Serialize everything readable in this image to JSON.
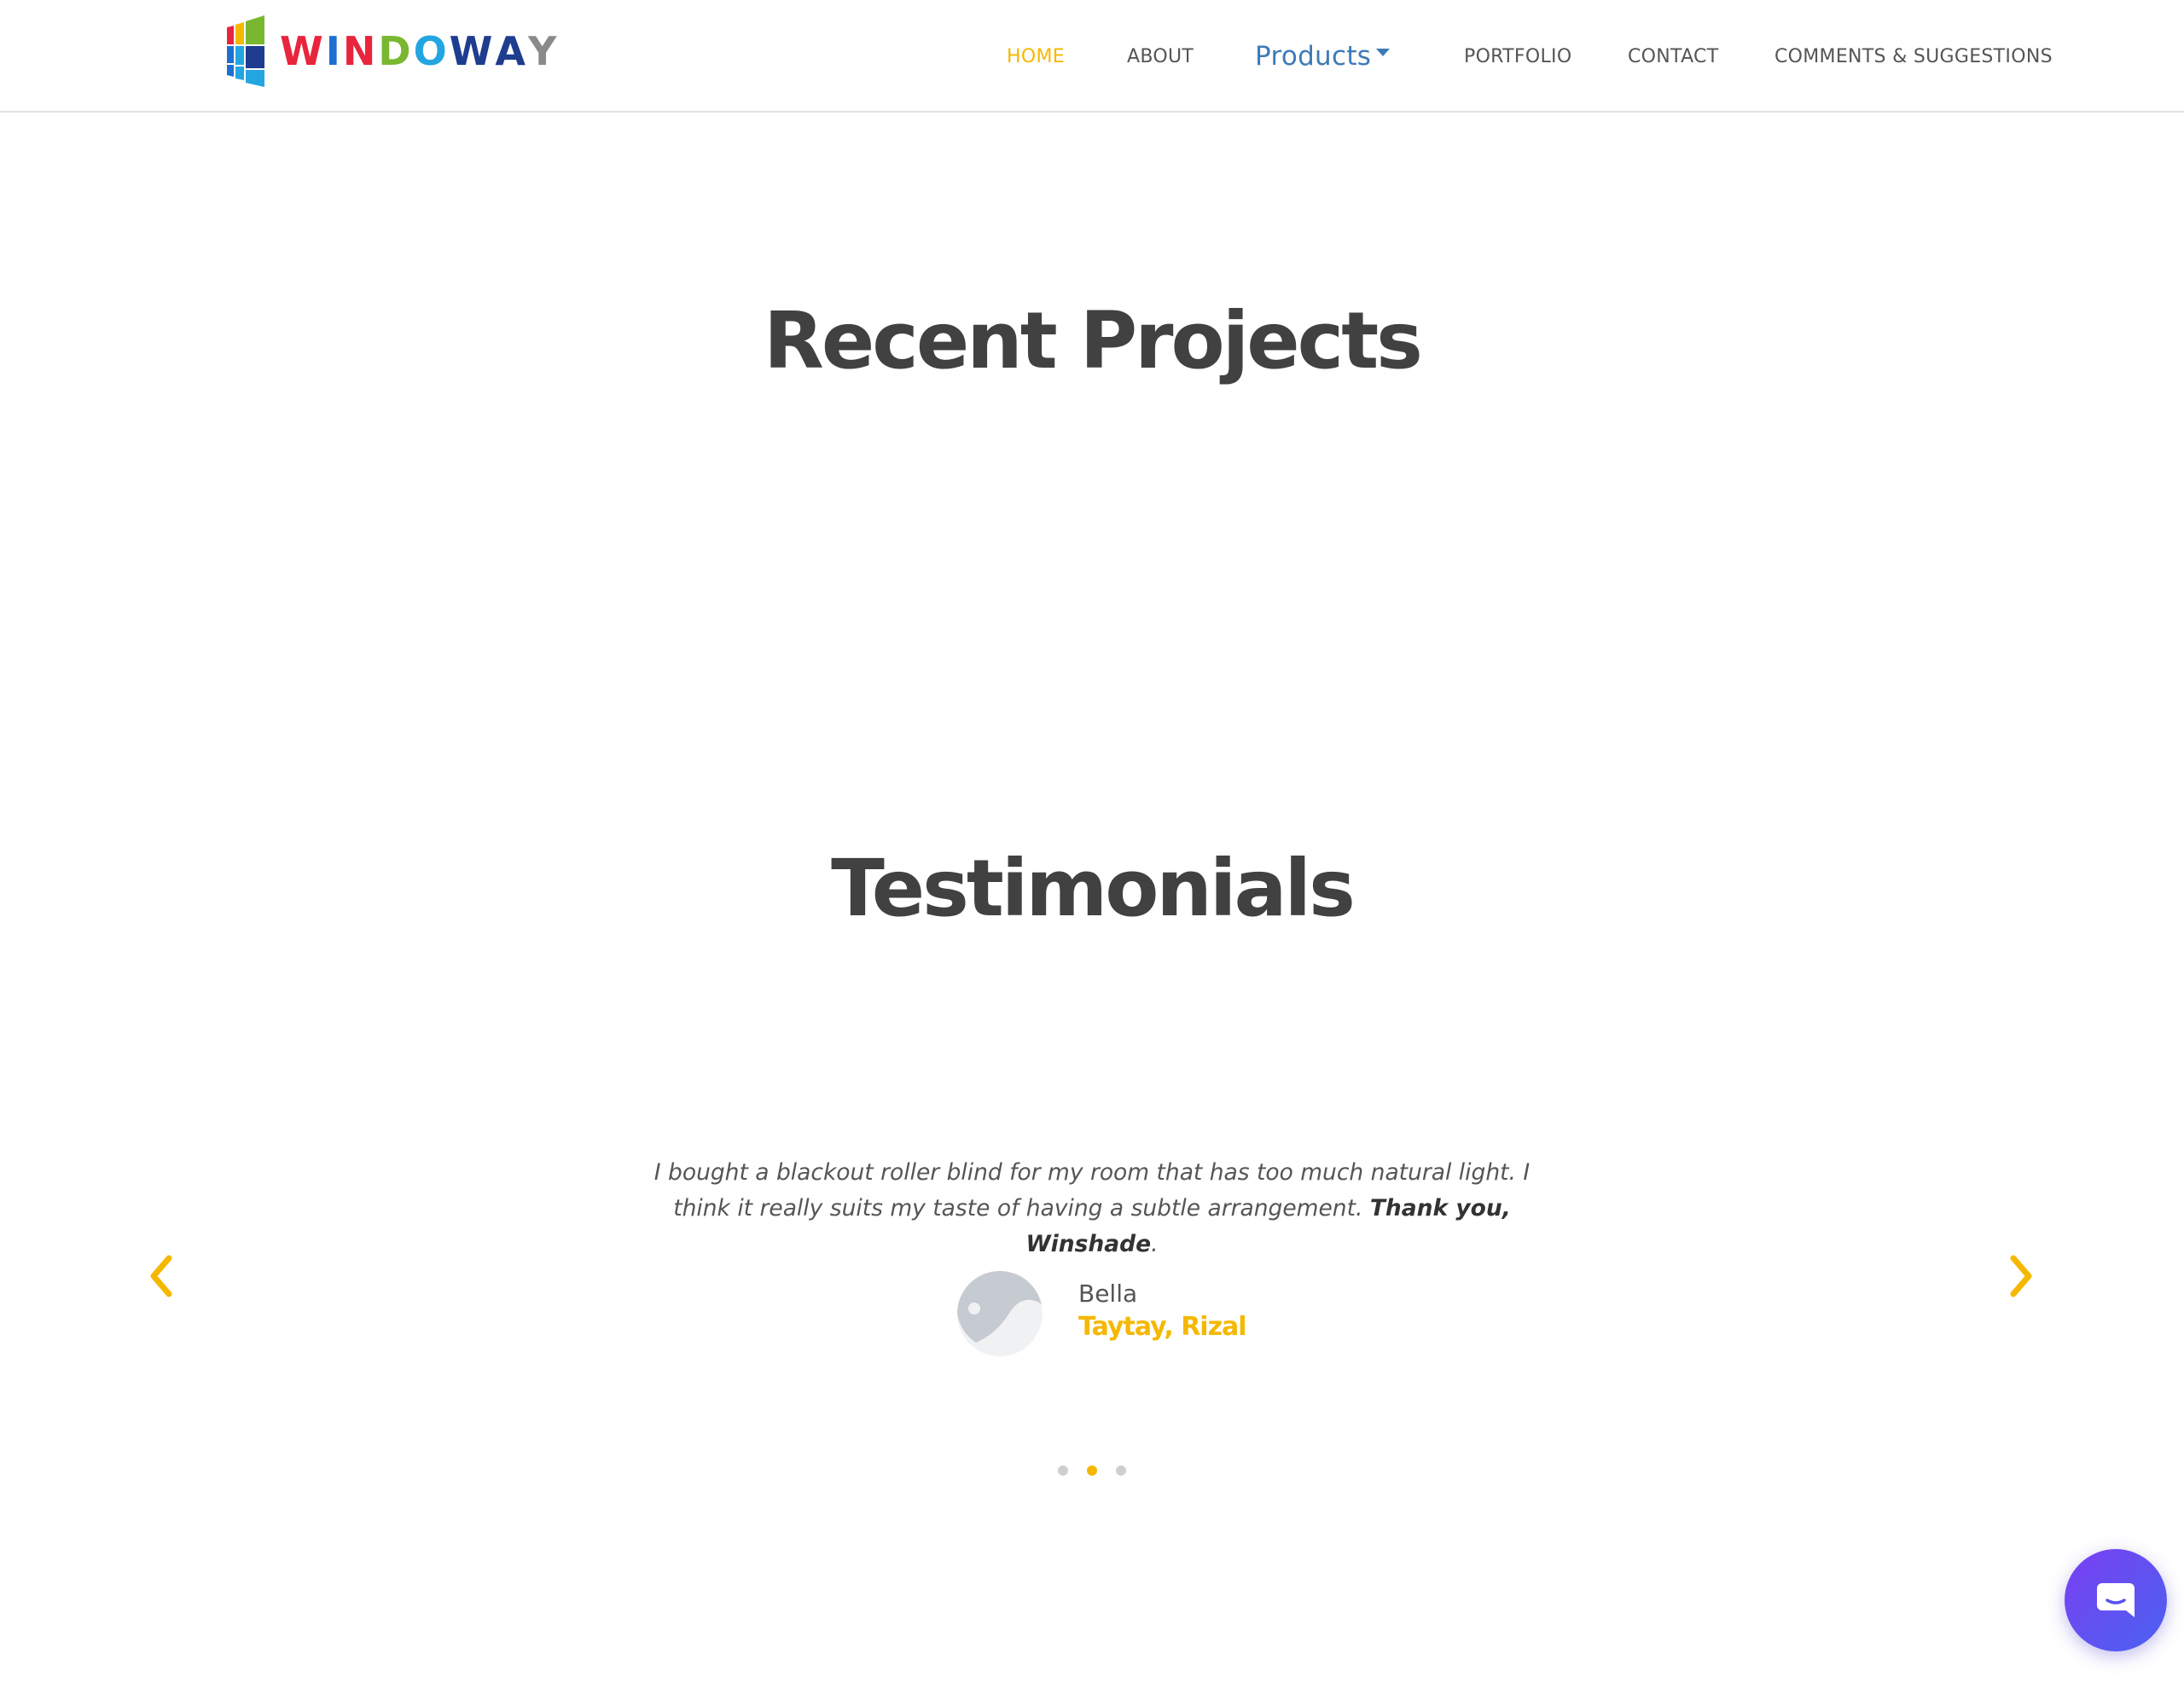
{
  "brand": {
    "name": "WINDOWAY",
    "letters": [
      {
        "char": "W",
        "color": "#e8253c"
      },
      {
        "char": "I",
        "color": "#1e6fd2"
      },
      {
        "char": "N",
        "color": "#e8253c"
      },
      {
        "char": "D",
        "color": "#7ab730"
      },
      {
        "char": "O",
        "color": "#23a6e0"
      },
      {
        "char": "W",
        "color": "#1e3d8f"
      },
      {
        "char": "A",
        "color": "#1e3d8f"
      },
      {
        "char": "Y",
        "color": "#8a8a8a"
      }
    ]
  },
  "nav": {
    "home": "HOME",
    "about": "ABOUT",
    "products": "Products",
    "portfolio": "PORTFOLIO",
    "contact": "CONTACT",
    "comments": "COMMENTS & SUGGESTIONS"
  },
  "sections": {
    "recent_projects_title": "Recent Projects",
    "testimonials_title": "Testimonials"
  },
  "testimonial": {
    "quote_text": "I bought a blackout roller blind for my room that has too much natural light. I think it really suits my taste of having a subtle arrangement.",
    "quote_emphasis": "Thank you, Winshade",
    "quote_end": ".",
    "name": "Bella",
    "location": "Taytay, Rizal"
  },
  "carousel": {
    "total_slides": 3,
    "active_slide": 2
  },
  "colors": {
    "accent": "#f5b800",
    "heading": "#414141",
    "link": "#3d7ab8",
    "chat_gradient_start": "#7b3ff2",
    "chat_gradient_end": "#4a62f0"
  },
  "icons": {
    "prev": "chevron-left-icon",
    "next": "chevron-right-icon",
    "chat": "chat-bubble-icon",
    "avatar": "avatar-placeholder-icon"
  }
}
